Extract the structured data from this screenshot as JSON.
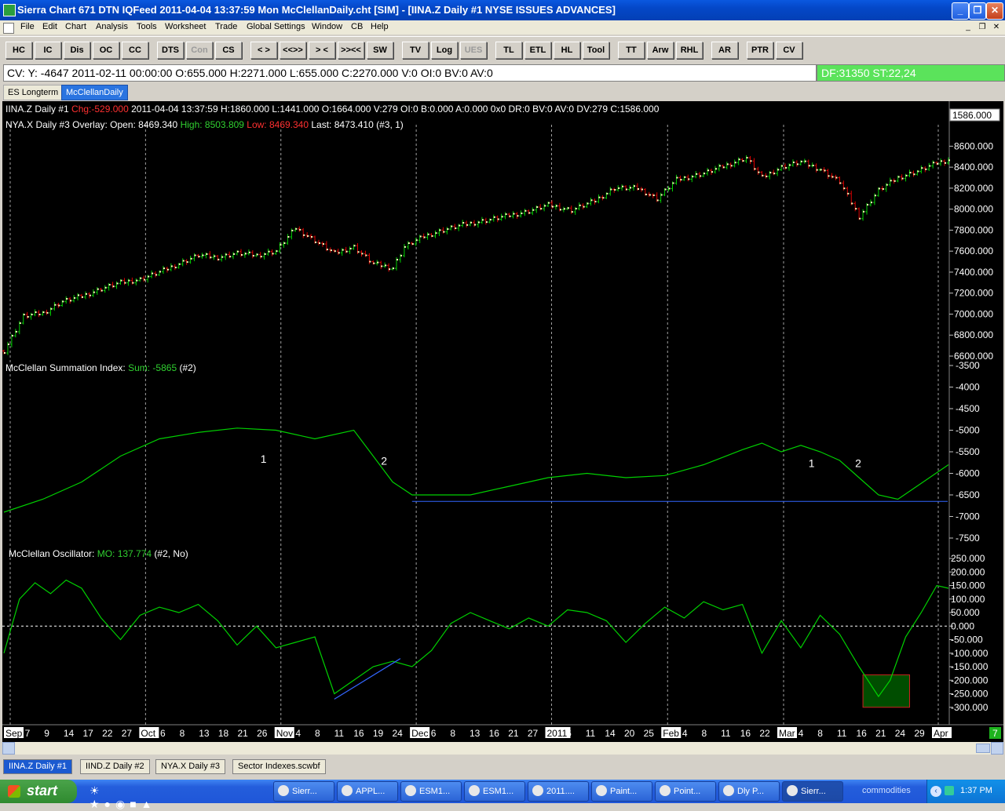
{
  "window": {
    "title": "Sierra Chart 671 DTN IQFeed 2011-04-04  13:37:59  Mon   McClellanDaily.cht [SIM] - [IINA.Z  Daily  #1  NYSE ISSUES ADVANCES]",
    "minimize_label": "_",
    "maximize_label": "❐",
    "close_label": "✕"
  },
  "menu": [
    "File",
    "Edit",
    "Chart",
    "Analysis",
    "Tools",
    "Worksheet",
    "Trade",
    "Global Settings",
    "Window",
    "CB",
    "Help"
  ],
  "mdi_controls": [
    "_",
    "❐",
    "✕"
  ],
  "toolbar": [
    {
      "label": "HC",
      "enabled": true
    },
    {
      "label": "IC",
      "enabled": true
    },
    {
      "label": "Dis",
      "enabled": true
    },
    {
      "label": "OC",
      "enabled": true
    },
    {
      "label": "CC",
      "enabled": true
    },
    {
      "label": "DTS",
      "enabled": true
    },
    {
      "label": "Con",
      "enabled": false
    },
    {
      "label": "CS",
      "enabled": true
    },
    {
      "label": "< >",
      "enabled": true
    },
    {
      "label": "<<>>",
      "enabled": true
    },
    {
      "label": "> <",
      "enabled": true
    },
    {
      "label": ">><<",
      "enabled": true
    },
    {
      "label": "SW",
      "enabled": true
    },
    {
      "label": "TV",
      "enabled": true
    },
    {
      "label": "Log",
      "enabled": true
    },
    {
      "label": "UES",
      "enabled": false
    },
    {
      "label": "TL",
      "enabled": true
    },
    {
      "label": "ETL",
      "enabled": true
    },
    {
      "label": "HL",
      "enabled": true
    },
    {
      "label": "Tool",
      "enabled": true
    },
    {
      "label": "TT",
      "enabled": true
    },
    {
      "label": "Arw",
      "enabled": true
    },
    {
      "label": "RHL",
      "enabled": true
    },
    {
      "label": "AR",
      "enabled": true
    },
    {
      "label": "PTR",
      "enabled": true
    },
    {
      "label": "CV",
      "enabled": true
    }
  ],
  "info_bar": "CV: Y: -4647  2011-02-11  00:00:00  O:655.000  H:2271.000  L:655.000  C:2270.000  V:0  OI:0  BV:0  AV:0",
  "df_bar": "DF:31350  ST:22,24",
  "chart_tabs": [
    "ES Longterm",
    "McClellanDaily"
  ],
  "colors": {
    "up": "#00d000",
    "down": "#e00000",
    "line": "#00d000",
    "blue": "#3366ff",
    "grid": "#a0a0a0",
    "box_fill": "#004d00",
    "box_border": "#d02020"
  },
  "header_line1": {
    "symbol": "IINA.Z  Daily  #1",
    "chg": "Chg:-529.000",
    "rest": " 2011-04-04 13:37:59 H:1860.000 L:1441.000 O:1664.000 V:279 OI:0 B:0.000 A:0.000 0x0 DR:0 BV:0 AV:0 DV:279 C:1586.000"
  },
  "header_line2": {
    "name": "NYA.X  Daily  #3 Overlay:  Open: 8469.340",
    "high": "High: 8503.809",
    "low": "Low: 8469.340",
    "last": "Last: 8473.410   (#3, 1)"
  },
  "price_flag": "1586.000",
  "summation": {
    "label": "McClellan Summation Index:",
    "sum": "Sum: -5865",
    "tag": "(#2)",
    "annotations": [
      "1",
      "2",
      "1",
      "2"
    ]
  },
  "oscillator": {
    "label": "McClellan Oscillator:",
    "mo": "MO: 137.774",
    "tag": "(#2, No)"
  },
  "corner_badge": "7",
  "x_labels": [
    {
      "t": "Sep",
      "box": true
    },
    {
      "t": "7"
    },
    {
      "t": "9"
    },
    {
      "t": "14"
    },
    {
      "t": "17"
    },
    {
      "t": "22"
    },
    {
      "t": "27"
    },
    {
      "t": "Oct",
      "box": true
    },
    {
      "t": "6"
    },
    {
      "t": "8"
    },
    {
      "t": "13"
    },
    {
      "t": "18"
    },
    {
      "t": "21"
    },
    {
      "t": "26"
    },
    {
      "t": "Nov",
      "box": true
    },
    {
      "t": "4"
    },
    {
      "t": "8"
    },
    {
      "t": "11"
    },
    {
      "t": "16"
    },
    {
      "t": "19"
    },
    {
      "t": "24"
    },
    {
      "t": "Dec",
      "box": true
    },
    {
      "t": "6"
    },
    {
      "t": "8"
    },
    {
      "t": "13"
    },
    {
      "t": "16"
    },
    {
      "t": "21"
    },
    {
      "t": "27"
    },
    {
      "t": "2011",
      "box": true
    },
    {
      "t": "6"
    },
    {
      "t": "11"
    },
    {
      "t": "14"
    },
    {
      "t": "20"
    },
    {
      "t": "25"
    },
    {
      "t": "Feb",
      "box": true
    },
    {
      "t": "4"
    },
    {
      "t": "8"
    },
    {
      "t": "11"
    },
    {
      "t": "16"
    },
    {
      "t": "22"
    },
    {
      "t": "Mar",
      "box": true
    },
    {
      "t": "4"
    },
    {
      "t": "8"
    },
    {
      "t": "11"
    },
    {
      "t": "16"
    },
    {
      "t": "21"
    },
    {
      "t": "24"
    },
    {
      "t": "29"
    },
    {
      "t": "Apr",
      "box": true
    }
  ],
  "sheet_tabs": [
    {
      "label": "IINA.Z  Daily  #1",
      "active": true
    },
    {
      "label": "IIND.Z  Daily  #2",
      "active": false
    },
    {
      "label": "NYA.X  Daily  #3",
      "active": false
    },
    {
      "label": "Sector Indexes.scwbf",
      "active": false
    }
  ],
  "taskbar": {
    "start_label": "start",
    "tasks": [
      "Sierr...",
      "APPL...",
      "ESM1...",
      "ESM1...",
      "2011....",
      "Paint...",
      "Point...",
      "Dly P...",
      "Sierr..."
    ],
    "commodities": "commodities",
    "clock": "1:37 PM"
  },
  "chart_data": [
    {
      "type": "bar",
      "title": "NYA.X  Daily  #3 Overlay",
      "y_ticks": [
        "8600.000",
        "8400.000",
        "8200.000",
        "8000.000",
        "7800.000",
        "7600.000",
        "7400.000",
        "7200.000",
        "7000.000",
        "6800.000",
        "6600.000"
      ],
      "ylim": [
        6600,
        8700
      ],
      "x_range": [
        "2010-09-03",
        "2011-04-04"
      ],
      "trend_close": [
        [
          0,
          6650
        ],
        [
          5,
          6980
        ],
        [
          10,
          7010
        ],
        [
          15,
          7120
        ],
        [
          20,
          7170
        ],
        [
          25,
          7240
        ],
        [
          30,
          7300
        ],
        [
          35,
          7330
        ],
        [
          40,
          7400
        ],
        [
          45,
          7480
        ],
        [
          50,
          7560
        ],
        [
          55,
          7540
        ],
        [
          60,
          7580
        ],
        [
          65,
          7560
        ],
        [
          70,
          7600
        ],
        [
          75,
          7820
        ],
        [
          80,
          7700
        ],
        [
          85,
          7580
        ],
        [
          90,
          7640
        ],
        [
          95,
          7480
        ],
        [
          100,
          7440
        ],
        [
          103,
          7640
        ],
        [
          108,
          7740
        ],
        [
          113,
          7800
        ],
        [
          118,
          7850
        ],
        [
          125,
          7900
        ],
        [
          130,
          7940
        ],
        [
          135,
          7980
        ],
        [
          140,
          8040
        ],
        [
          146,
          7990
        ],
        [
          152,
          8080
        ],
        [
          157,
          8200
        ],
        [
          163,
          8200
        ],
        [
          168,
          8100
        ],
        [
          173,
          8280
        ],
        [
          180,
          8340
        ],
        [
          186,
          8420
        ],
        [
          191,
          8490
        ],
        [
          195,
          8300
        ],
        [
          200,
          8400
        ],
        [
          205,
          8450
        ],
        [
          210,
          8380
        ],
        [
          215,
          8260
        ],
        [
          220,
          7930
        ],
        [
          225,
          8180
        ],
        [
          230,
          8300
        ],
        [
          235,
          8360
        ],
        [
          240,
          8440
        ],
        [
          243,
          8470
        ]
      ]
    },
    {
      "type": "line",
      "title": "McClellan Summation Index",
      "y_ticks": [
        "-3500",
        "-4000",
        "-4500",
        "-5000",
        "-5500",
        "-6000",
        "-6500",
        "-7000",
        "-7500"
      ],
      "ylim": [
        -7500,
        -3500
      ],
      "x": [
        0,
        10,
        20,
        30,
        40,
        50,
        60,
        70,
        80,
        90,
        100,
        105,
        110,
        120,
        130,
        140,
        150,
        160,
        170,
        180,
        190,
        195,
        200,
        205,
        210,
        215,
        220,
        225,
        230,
        243
      ],
      "values": [
        -6900,
        -6600,
        -6200,
        -5600,
        -5200,
        -5050,
        -4950,
        -5000,
        -5200,
        -5000,
        -6200,
        -6500,
        -6500,
        -6500,
        -6300,
        -6100,
        -6000,
        -6100,
        -6050,
        -5800,
        -5450,
        -5300,
        -5500,
        -5350,
        -5500,
        -5700,
        -6100,
        -6500,
        -6600,
        -5800
      ],
      "support_level": -6650
    },
    {
      "type": "line",
      "title": "McClellan Oscillator",
      "y_ticks": [
        "250.000",
        "200.000",
        "150.000",
        "100.000",
        "50.000",
        "0.000",
        "-50.000",
        "-100.000",
        "-150.000",
        "-200.000",
        "-250.000",
        "-300.000"
      ],
      "ylim": [
        -350,
        250
      ],
      "x": [
        0,
        4,
        8,
        12,
        16,
        20,
        25,
        30,
        35,
        40,
        45,
        50,
        55,
        60,
        65,
        70,
        75,
        80,
        85,
        90,
        95,
        100,
        105,
        110,
        115,
        120,
        125,
        130,
        135,
        140,
        145,
        150,
        155,
        160,
        165,
        170,
        175,
        180,
        185,
        190,
        195,
        200,
        205,
        210,
        215,
        220,
        225,
        228,
        232,
        236,
        240,
        243
      ],
      "values": [
        -100,
        100,
        160,
        120,
        170,
        140,
        30,
        -50,
        40,
        70,
        50,
        80,
        20,
        -70,
        0,
        -80,
        -60,
        -40,
        -250,
        -200,
        -150,
        -130,
        -150,
        -90,
        10,
        50,
        20,
        -10,
        30,
        0,
        60,
        50,
        20,
        -60,
        10,
        70,
        30,
        90,
        60,
        80,
        -100,
        20,
        -80,
        40,
        -30,
        -150,
        -260,
        -200,
        -40,
        50,
        150,
        140
      ]
    }
  ]
}
